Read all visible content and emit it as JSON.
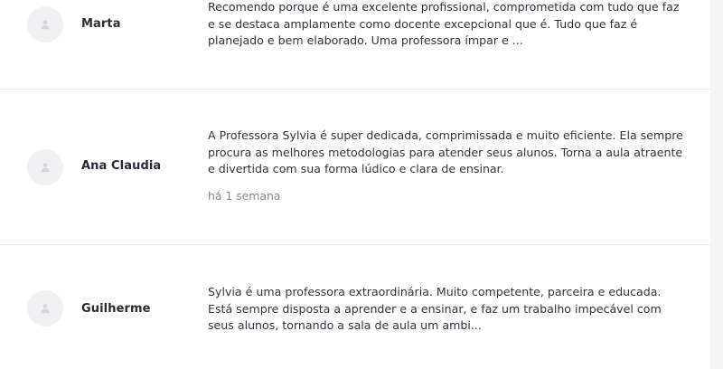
{
  "reviews": [
    {
      "name": "Marta",
      "text": "Recomendo porque é uma excelente profissional, comprometida com tudo que faz e se destaca amplamente como docente excepcional que é. Tudo que faz é planejado e bem elaborado. Uma professora ímpar e ..."
    },
    {
      "name": "Ana Claudia",
      "text": "A Professora Sylvia é super dedicada, comprimissada e muito eficiente. Ela sempre procura as melhores metodologias para atender seus alunos. Torna a aula atraente e divertida com sua forma lúdico e clara de ensinar.",
      "time": "há 1 semana"
    },
    {
      "name": "Guilherme",
      "text": "Sylvia é uma professora extraordinária. Muito competente, parceira e educada. Está sempre disposta a aprender e a ensinar, e faz um trabalho impecável com seus alunos, tornando a sala de aula um ambi..."
    }
  ],
  "icons": {
    "avatar": "user-icon"
  }
}
